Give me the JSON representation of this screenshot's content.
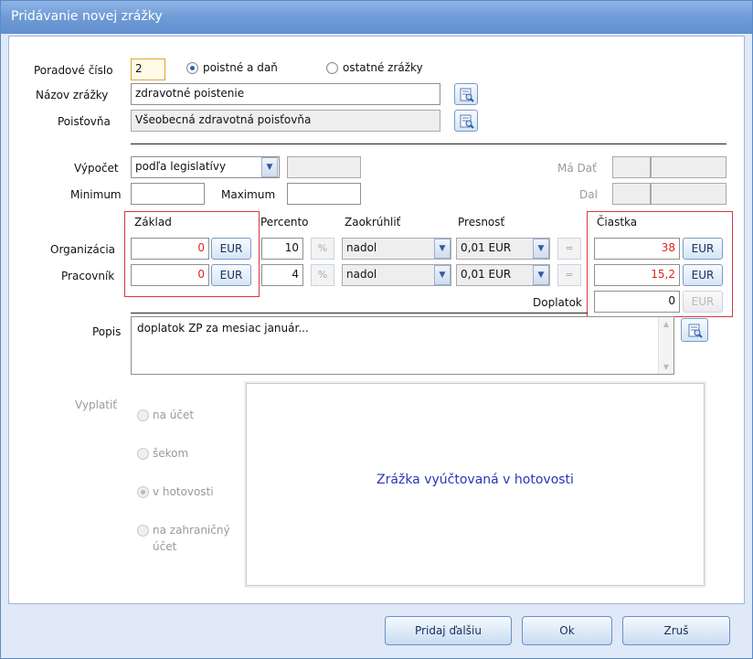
{
  "window": {
    "title": "Pridávanie novej zrážky"
  },
  "form": {
    "poradove_cislo": {
      "label": "Poradové číslo",
      "value": "2"
    },
    "typ": {
      "option1": "poistné a daň",
      "option2": "ostatné zrážky",
      "selected": "poistné a daň"
    },
    "nazov": {
      "label": "Názov zrážky",
      "value": "zdravotné poistenie"
    },
    "poistovna": {
      "label": "Poisťovňa",
      "value": "Všeobecná zdravotná poisťovňa"
    },
    "vypocet": {
      "label": "Výpočet",
      "value": "podľa legislatívy"
    },
    "ma_dat": {
      "label": "Má Dať"
    },
    "dal": {
      "label": "Dal"
    },
    "minimum": {
      "label": "Minimum",
      "value": ""
    },
    "maximum": {
      "label": "Maximum",
      "value": ""
    }
  },
  "grid": {
    "headers": {
      "zaklad": "Základ",
      "percento": "Percento",
      "zaokruhlit": "Zaokrúhliť",
      "presnost": "Presnosť",
      "ciastka": "Čiastka"
    },
    "rows": [
      {
        "label": "Organizácia",
        "zaklad": "0",
        "currency": "EUR",
        "percento": "10",
        "pct_symbol": "%",
        "zaokruhlit": "nadol",
        "presnost": "0,01 EUR",
        "eq": "=",
        "ciastka": "38"
      },
      {
        "label": "Pracovník",
        "zaklad": "0",
        "currency": "EUR",
        "percento": "4",
        "pct_symbol": "%",
        "zaokruhlit": "nadol",
        "presnost": "0,01 EUR",
        "eq": "=",
        "ciastka": "15,2"
      }
    ],
    "doplatok": {
      "label": "Doplatok",
      "value": "0",
      "currency": "EUR"
    }
  },
  "popis": {
    "label": "Popis",
    "value": "doplatok ZP za mesiac január..."
  },
  "vyplatit": {
    "label": "Vyplatiť",
    "options": [
      "na účet",
      "šekom",
      "v hotovosti",
      "na zahraničný účet"
    ],
    "option4_line1": "na zahraničný",
    "option4_line2": "účet",
    "selected": "v hotovosti",
    "message": "Zrážka vyúčtovaná v hotovosti"
  },
  "buttons": {
    "add_next": "Pridaj ďalšiu",
    "ok": "Ok",
    "cancel": "Zruš"
  },
  "colors": {
    "accent": "#2a35b8",
    "red_value": "#e02020",
    "highlight_box": "#d8363f"
  }
}
